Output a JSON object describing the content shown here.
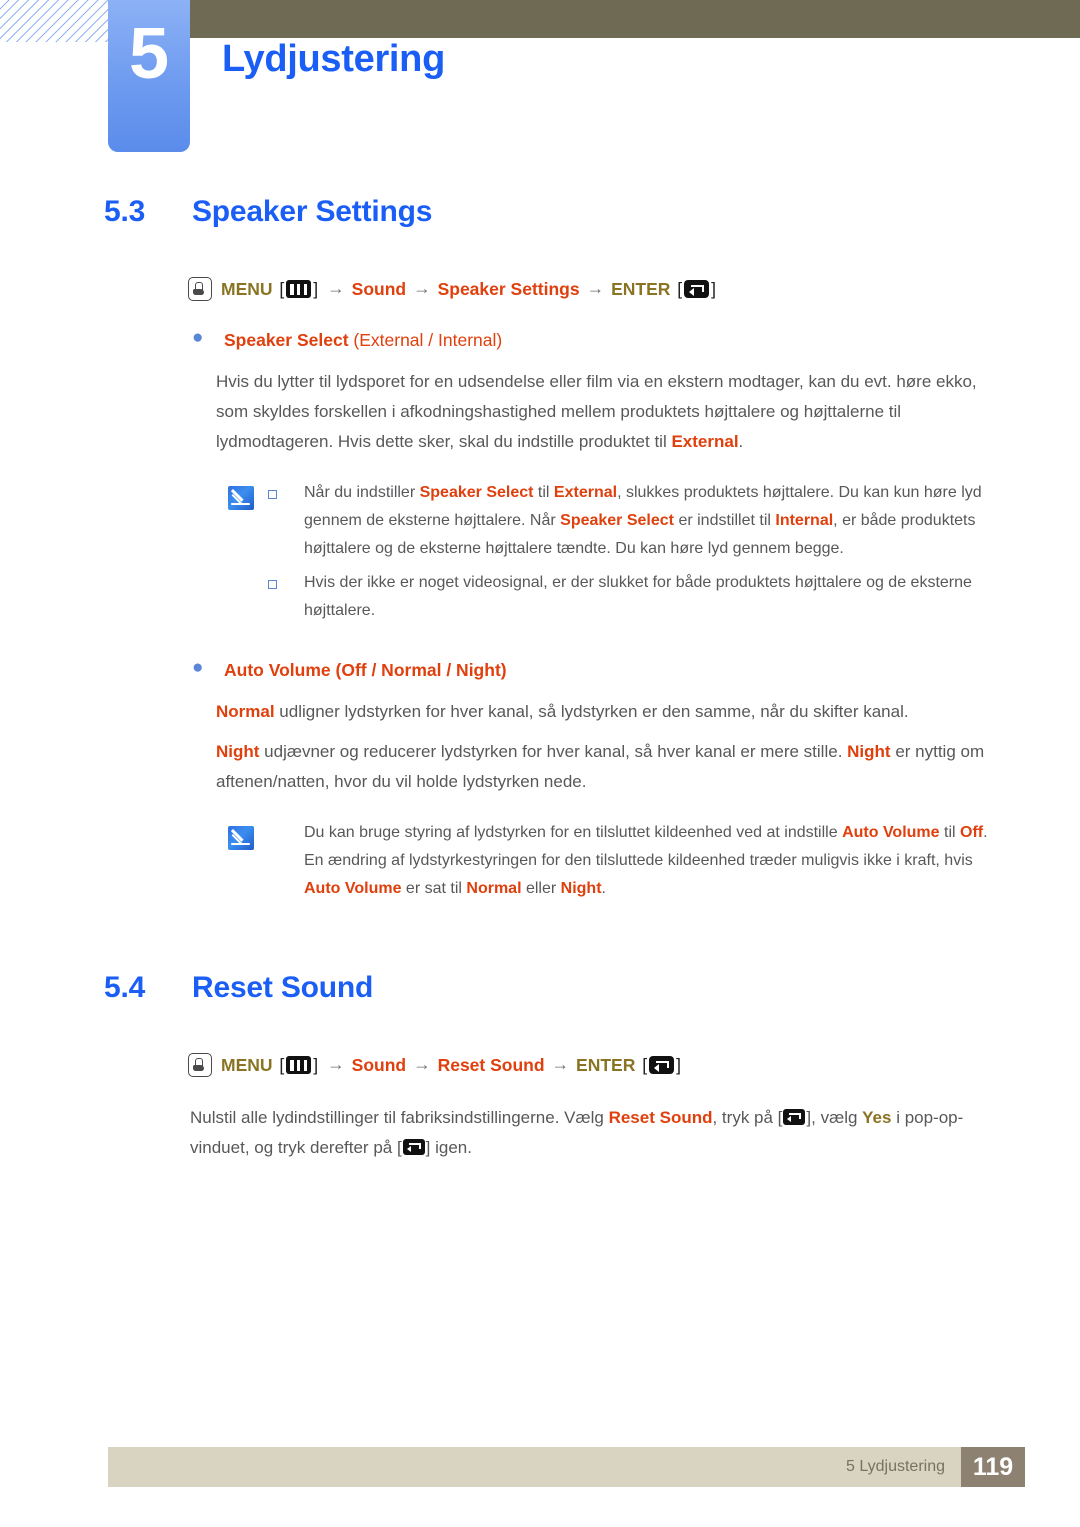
{
  "header": {
    "chapter_number": "5",
    "chapter_title": "Lydjustering",
    "accent_blue": "#1a5ef5",
    "tab_blue": "#6e9bf0",
    "olive": "#6e6a53"
  },
  "sections": [
    {
      "number": "5.3",
      "title": "Speaker Settings",
      "menu_path": {
        "hand_icon": "hand-press-icon",
        "menu_label": "MENU",
        "menu_icon": "menu-bars-icon",
        "steps": [
          "Sound",
          "Speaker Settings"
        ],
        "enter_label": "ENTER",
        "enter_icon": "enter-return-icon",
        "arrow": "→"
      },
      "items": [
        {
          "label_bold": "Speaker Select",
          "label_options": "(External / Internal)",
          "paragraphs": [
            {
              "runs": [
                {
                  "t": "Hvis du lytter til lydsporet for en udsendelse eller film via en ekstern modtager, kan du evt. høre ekko, som skyldes forskellen i afkodningshastighed mellem produktets højttalere og højttalerne til lydmodtageren. Hvis dette sker, skal du indstille produktet til ",
                  "s": "n"
                },
                {
                  "t": "External",
                  "s": "hl"
                },
                {
                  "t": ".",
                  "s": "n"
                }
              ]
            }
          ],
          "note": {
            "icon": "note-pen-icon",
            "items": [
              {
                "bullet": true,
                "runs": [
                  {
                    "t": "Når du indstiller ",
                    "s": "n"
                  },
                  {
                    "t": "Speaker Select",
                    "s": "hl"
                  },
                  {
                    "t": " til ",
                    "s": "n"
                  },
                  {
                    "t": "External",
                    "s": "hl"
                  },
                  {
                    "t": ", slukkes produktets højttalere. Du kan kun høre lyd gennem de eksterne højttalere. Når ",
                    "s": "n"
                  },
                  {
                    "t": "Speaker Select",
                    "s": "hl"
                  },
                  {
                    "t": " er indstillet til ",
                    "s": "n"
                  },
                  {
                    "t": "Internal",
                    "s": "hl"
                  },
                  {
                    "t": ", er både produktets højttalere og de eksterne højttalere tændte. Du kan høre lyd gennem begge.",
                    "s": "n"
                  }
                ]
              },
              {
                "bullet": true,
                "runs": [
                  {
                    "t": "Hvis der ikke er noget videosignal, er der slukket for både produktets højttalere og de eksterne højttalere.",
                    "s": "n"
                  }
                ]
              }
            ]
          }
        },
        {
          "label_bold": "Auto Volume",
          "label_options": "(Off / Normal / Night)",
          "paragraphs": [
            {
              "runs": [
                {
                  "t": "Normal",
                  "s": "hl"
                },
                {
                  "t": " udligner lydstyrken for hver kanal, så lydstyrken er den samme, når du skifter kanal.",
                  "s": "n"
                }
              ]
            },
            {
              "runs": [
                {
                  "t": "Night",
                  "s": "hl"
                },
                {
                  "t": " udjævner og reducerer lydstyrken for hver kanal, så hver kanal er mere stille. ",
                  "s": "n"
                },
                {
                  "t": "Night",
                  "s": "hl"
                },
                {
                  "t": " er nyttig om aftenen/natten, hvor du vil holde lydstyrken nede.",
                  "s": "n"
                }
              ]
            }
          ],
          "note": {
            "icon": "note-pen-icon",
            "items": [
              {
                "bullet": false,
                "runs": [
                  {
                    "t": "Du kan bruge styring af lydstyrken for en tilsluttet kildeenhed ved at indstille ",
                    "s": "n"
                  },
                  {
                    "t": "Auto Volume",
                    "s": "hl"
                  },
                  {
                    "t": " til ",
                    "s": "n"
                  },
                  {
                    "t": "Off",
                    "s": "hl"
                  },
                  {
                    "t": ". En ændring af lydstyrkestyringen for den tilsluttede kildeenhed træder muligvis ikke i kraft, hvis ",
                    "s": "n"
                  },
                  {
                    "t": "Auto Volume",
                    "s": "hl"
                  },
                  {
                    "t": " er sat til ",
                    "s": "n"
                  },
                  {
                    "t": "Normal",
                    "s": "hl"
                  },
                  {
                    "t": " eller ",
                    "s": "n"
                  },
                  {
                    "t": "Night",
                    "s": "hl"
                  },
                  {
                    "t": ".",
                    "s": "n"
                  }
                ]
              }
            ]
          }
        }
      ]
    },
    {
      "number": "5.4",
      "title": "Reset Sound",
      "menu_path": {
        "hand_icon": "hand-press-icon",
        "menu_label": "MENU",
        "menu_icon": "menu-bars-icon",
        "steps": [
          "Sound",
          "Reset Sound"
        ],
        "enter_label": "ENTER",
        "enter_icon": "enter-return-icon",
        "arrow": "→"
      },
      "body": {
        "runs": [
          {
            "t": "Nulstil alle lydindstillinger til fabriksindstillingerne. Vælg ",
            "s": "n"
          },
          {
            "t": "Reset Sound",
            "s": "hl"
          },
          {
            "t": ", tryk på [",
            "s": "n"
          },
          {
            "t": "",
            "s": "enter-icon"
          },
          {
            "t": "], vælg ",
            "s": "n"
          },
          {
            "t": "Yes",
            "s": "olive"
          },
          {
            "t": " i pop-op-vinduet, og tryk derefter på [",
            "s": "n"
          },
          {
            "t": "",
            "s": "enter-icon"
          },
          {
            "t": "] igen.",
            "s": "n"
          }
        ]
      }
    }
  ],
  "footer": {
    "label": "5 Lydjustering",
    "page": "119",
    "bar_color": "#d9d3c1",
    "page_box_color": "#8d8172"
  }
}
